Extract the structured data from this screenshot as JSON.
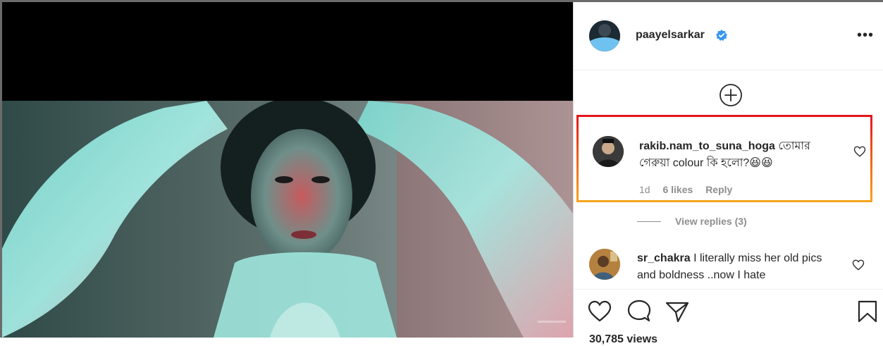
{
  "post": {
    "author": "paayelsarkar",
    "verified": true,
    "more_label": "•••"
  },
  "comments": [
    {
      "username": "rakib.nam_to_suna_hoga",
      "text": "তোমার গেরুয়া colour কি হলো?😆😆",
      "age": "1d",
      "likes": "6 likes",
      "reply_label": "Reply",
      "highlighted": true
    },
    {
      "username": "sr_chakra",
      "text": "I literally miss her old pics and boldness ..now I hate"
    }
  ],
  "view_replies": "View replies (3)",
  "likes_partial": "30,785 views",
  "icons": {
    "load_more": "plus-circle-icon",
    "like": "heart-icon",
    "comment": "comment-icon",
    "share": "paper-plane-icon",
    "save": "bookmark-icon"
  },
  "colors": {
    "highlight_top": "#e5141b",
    "highlight_bottom": "#f7a51d",
    "verified": "#3897f0",
    "muted_text": "#8e8e8e"
  }
}
